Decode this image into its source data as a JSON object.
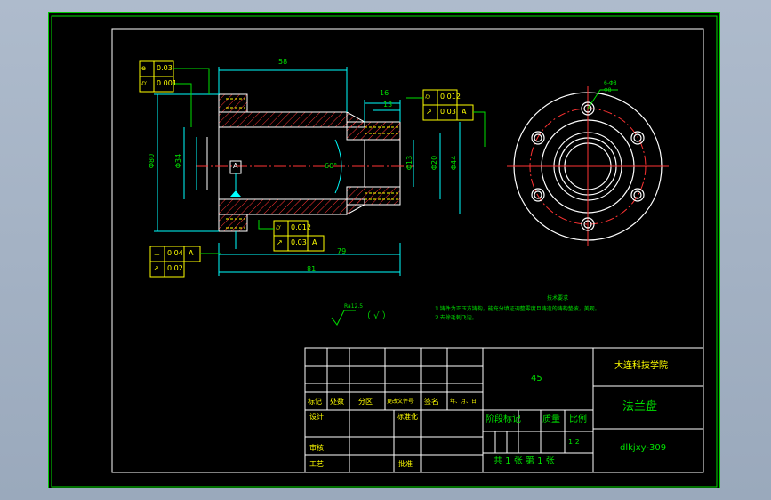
{
  "dimensions": {
    "overall_length": "58",
    "width_16": "16",
    "width_13": "13",
    "length_79": "79",
    "length_81": "81",
    "dia_left_outer": "Φ80",
    "dia_left_bore": "Φ34",
    "dia_right_small": "Φ13",
    "dia_right_mid": "Φ20",
    "dia_right_outer": "Φ44",
    "chamfer_angle": "60°",
    "hole_callout_1": "6-Φ8",
    "hole_callout_2": "Φ8"
  },
  "tolerances": {
    "left_top_row1_value": "0.03",
    "left_top_row2_value": "0.001",
    "right_top_row1_value": "0.012",
    "right_top_row2_value": "0.03",
    "right_top_row2_datum": "A",
    "mid_row1_value": "0.012",
    "mid_row2_value": "0.03",
    "mid_row2_datum": "A",
    "bottom_row1_value": "0.04",
    "bottom_row1_datum": "A",
    "bottom_row2_value": "0.02",
    "datum_center": "A"
  },
  "surface_finish": {
    "ra": "Ra12.5",
    "paren": "（ √ ）"
  },
  "tech_notes": {
    "heading": "技术要求",
    "line1": "1.铸件为正压方铸构，能充分填证调整零度且铸造的铸构垫坡，美观。",
    "line2": "2.去除毛刺飞边。"
  },
  "title_block": {
    "material": "45",
    "school": "大连科技学院",
    "part_name": "法兰盘",
    "drawing_code": "dlkjxy-309",
    "scale": "1:2",
    "sheet_info": "共 1 张  第 1 张",
    "stage_label": "阶段标记",
    "weight_label": "质量",
    "scale_label": "比例",
    "row_labels": {
      "mark": "标记",
      "count": "处数",
      "zone": "分区",
      "doc_no": "更改文件号",
      "sign": "签名",
      "date": "年、月、日",
      "design": "设计",
      "standard": "标准化",
      "review": "审核",
      "craft": "工艺",
      "approve": "批准"
    }
  },
  "colors": {
    "background": "#000000",
    "outline": "#00e000",
    "hatch": "#ff3333",
    "hidden": "#ffff00",
    "center": "#ff3333",
    "dimension": "#00ffff",
    "frame": "#ffffff"
  }
}
